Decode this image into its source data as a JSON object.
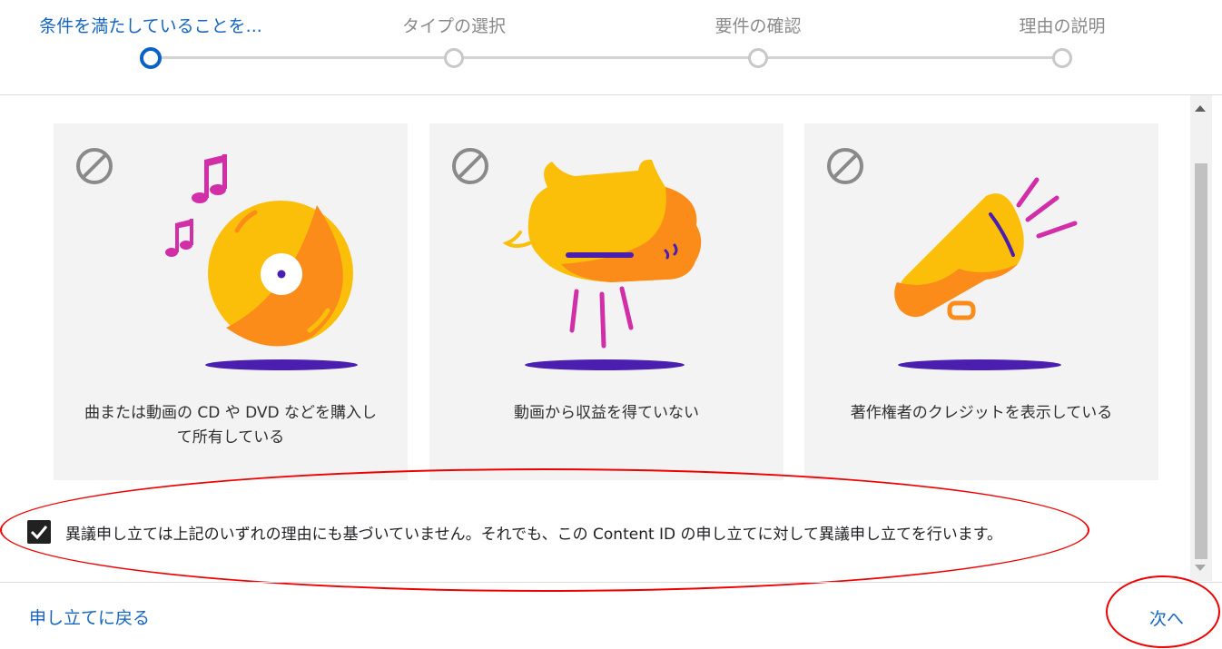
{
  "stepper": {
    "steps": [
      {
        "label": "条件を満たしていることを..."
      },
      {
        "label": "タイプの選択"
      },
      {
        "label": "要件の確認"
      },
      {
        "label": "理由の説明"
      }
    ]
  },
  "cards": [
    {
      "label": "曲または動画の CD や DVD などを購入して所有している",
      "icon": "not-allowed-icon",
      "illustration": "vinyl-record-music-notes"
    },
    {
      "label": "動画から収益を得ていない",
      "icon": "not-allowed-icon",
      "illustration": "piggy-bank"
    },
    {
      "label": "著作権者のクレジットを表示している",
      "icon": "not-allowed-icon",
      "illustration": "megaphone"
    }
  ],
  "agreement": {
    "checked": true,
    "text": "異議申し立ては上記のいずれの理由にも基づいていません。それでも、この Content ID の申し立てに対して異議申し立てを行います。"
  },
  "footer": {
    "back_label": "申し立てに戻る",
    "next_label": "次へ"
  },
  "colors": {
    "accent": "#1565c0",
    "annotation": "#e00000",
    "illustration_yellow": "#fbbf0a",
    "illustration_orange": "#fb8c1a",
    "illustration_purple": "#4a1fb0",
    "illustration_magenta": "#d12ea8"
  }
}
